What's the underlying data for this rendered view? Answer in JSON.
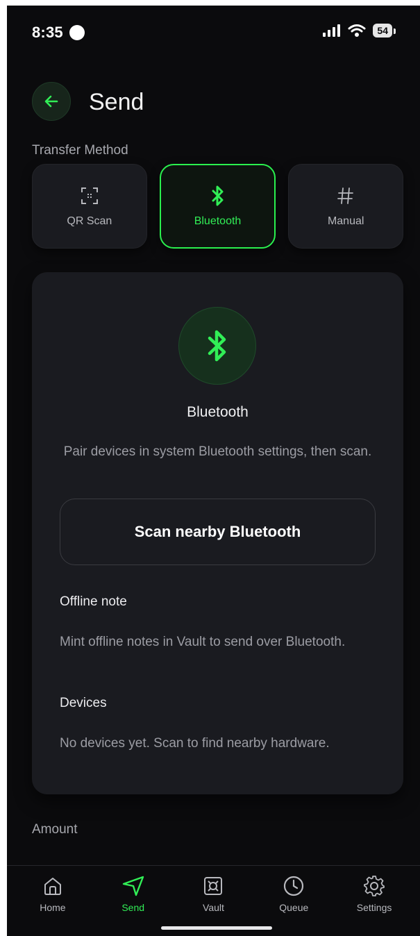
{
  "status_bar": {
    "time": "8:35",
    "battery": "54"
  },
  "header": {
    "title": "Send"
  },
  "transfer": {
    "label": "Transfer Method",
    "methods": [
      {
        "label": "QR Scan",
        "icon": "qr-scan-icon"
      },
      {
        "label": "Bluetooth",
        "icon": "bluetooth-icon",
        "selected": true
      },
      {
        "label": "Manual",
        "icon": "hash-icon"
      }
    ]
  },
  "bluetooth_card": {
    "title": "Bluetooth",
    "description": "Pair devices in system Bluetooth settings, then scan.",
    "scan_button": "Scan nearby Bluetooth",
    "offline_heading": "Offline note",
    "offline_text": "Mint offline notes in Vault to send over Bluetooth.",
    "devices_heading": "Devices",
    "devices_text": "No devices yet. Scan to find nearby hardware."
  },
  "amount": {
    "label": "Amount"
  },
  "tabs": [
    {
      "label": "Home",
      "icon": "home-icon"
    },
    {
      "label": "Send",
      "icon": "send-icon",
      "active": true
    },
    {
      "label": "Vault",
      "icon": "vault-icon"
    },
    {
      "label": "Queue",
      "icon": "clock-icon"
    },
    {
      "label": "Settings",
      "icon": "gear-icon"
    }
  ],
  "colors": {
    "accent": "#2af04e",
    "background": "#0b0b0d",
    "surface": "#1a1b20"
  }
}
